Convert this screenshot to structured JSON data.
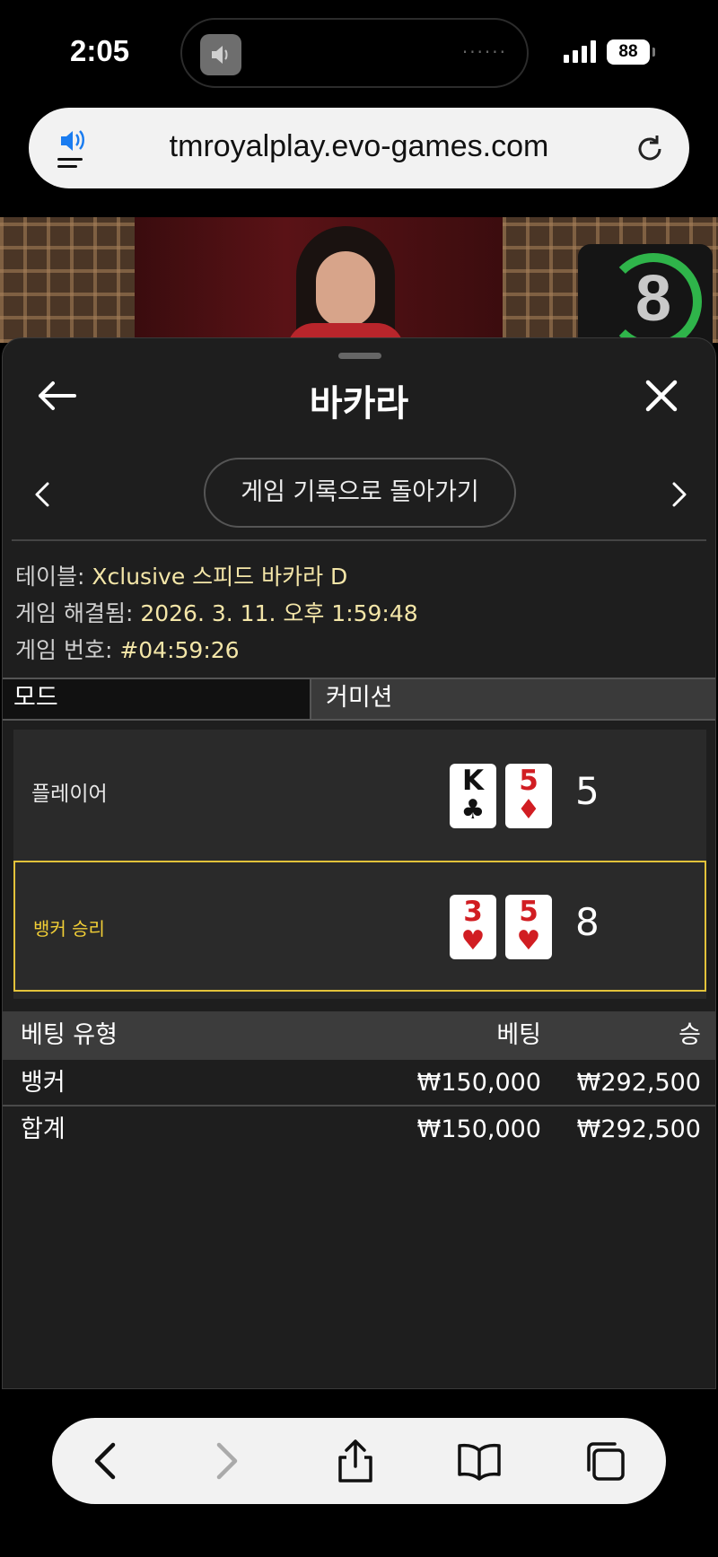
{
  "status_bar": {
    "time": "2:05",
    "battery": "88"
  },
  "browser": {
    "url": "tmroyalplay.evo-games.com"
  },
  "video": {
    "timer_value": "8"
  },
  "panel": {
    "title": "바카라",
    "back_to_history_label": "게임 기록으로 돌아가기",
    "info": {
      "table_label": "테이블:",
      "table_value": "Xclusive 스피드 바카라 D",
      "resolved_label": "게임 해결됨:",
      "resolved_value": "2026. 3. 11. 오후 1:59:48",
      "game_number_label": "게임 번호:",
      "game_number_value": "#04:59:26"
    },
    "mode_label": "모드",
    "mode_value": "커미션",
    "player_hand": {
      "label": "플레이어",
      "cards": [
        {
          "rank": "K",
          "suit": "♣",
          "color": "#111111"
        },
        {
          "rank": "5",
          "suit": "♦",
          "color": "#d11d22"
        }
      ],
      "score": "5"
    },
    "banker_hand": {
      "label": "뱅커 승리",
      "cards": [
        {
          "rank": "3",
          "suit": "♥",
          "color": "#d11d22"
        },
        {
          "rank": "5",
          "suit": "♥",
          "color": "#d11d22"
        }
      ],
      "score": "8"
    },
    "bets_table": {
      "headers": {
        "type": "베팅 유형",
        "bet": "베팅",
        "win": "승"
      },
      "rows": [
        {
          "type": "뱅커",
          "bet": "₩150,000",
          "win": "₩292,500"
        },
        {
          "type": "합계",
          "bet": "₩150,000",
          "win": "₩292,500"
        }
      ]
    }
  },
  "colors": {
    "winner_highlight": "#e2c23a",
    "value_text": "#f4e6a8",
    "timer_ring": "#2fb44a"
  },
  "toolbar_icons": [
    "back-icon",
    "forward-icon",
    "share-icon",
    "bookmarks-icon",
    "tabs-icon"
  ]
}
